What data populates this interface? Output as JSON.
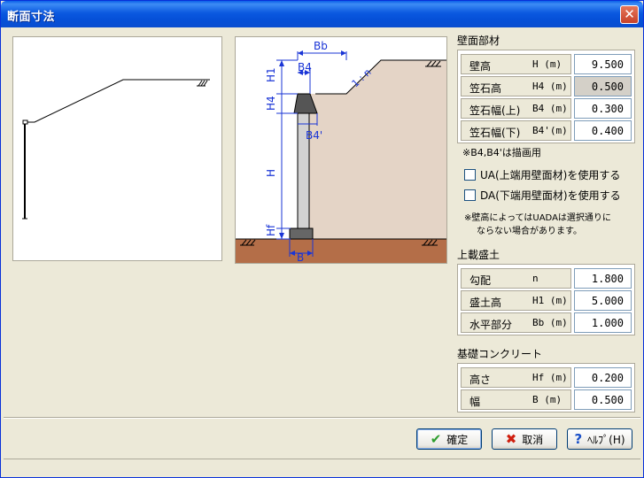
{
  "window": {
    "title": "断面寸法",
    "close_symbol": "✕"
  },
  "wall_section": {
    "title": "壁面部材",
    "rows": [
      {
        "name": "壁高",
        "unit": "H (m)",
        "value": "9.500"
      },
      {
        "name": "笠石高",
        "unit": "H4 (m)",
        "value": "0.500"
      },
      {
        "name": "笠石幅(上)",
        "unit": "B4 (m)",
        "value": "0.300"
      },
      {
        "name": "笠石幅(下)",
        "unit": "B4'(m)",
        "value": "0.400"
      }
    ],
    "note": "※B4,B4'は描画用",
    "checkbox_ua": "UA(上端用壁面材)を使用する",
    "checkbox_da": "DA(下端用壁面材)を使用する",
    "note2_line1": "※壁高によってはUADAは選択通りに",
    "note2_line2": "ならない場合があります。"
  },
  "fill_section": {
    "title": "上載盛土",
    "rows": [
      {
        "name": "勾配",
        "unit": "n",
        "value": "1.800"
      },
      {
        "name": "盛土高",
        "unit": "H1 (m)",
        "value": "5.000"
      },
      {
        "name": "水平部分",
        "unit": "Bb (m)",
        "value": "1.000"
      }
    ]
  },
  "foundation_section": {
    "title": "基礎コンクリート",
    "rows": [
      {
        "name": "高さ",
        "unit": "Hf (m)",
        "value": "0.200"
      },
      {
        "name": "幅",
        "unit": "B (m)",
        "value": "0.500"
      }
    ]
  },
  "diagram_labels": {
    "bb": "Bb",
    "b4": "B4",
    "slope": "1 : n",
    "h1": "H1",
    "h4": "H4",
    "b4p": "B4'",
    "h": "H",
    "hf": "Hf",
    "b": "B"
  },
  "buttons": {
    "ok": "確定",
    "cancel": "取消",
    "help": "ﾍﾙﾌﾟ(H)"
  },
  "colors": {
    "soil": "#E4D4C6",
    "ground": "#B46E48",
    "dim": "#1A35D6",
    "wall": "#D2D2D2"
  }
}
